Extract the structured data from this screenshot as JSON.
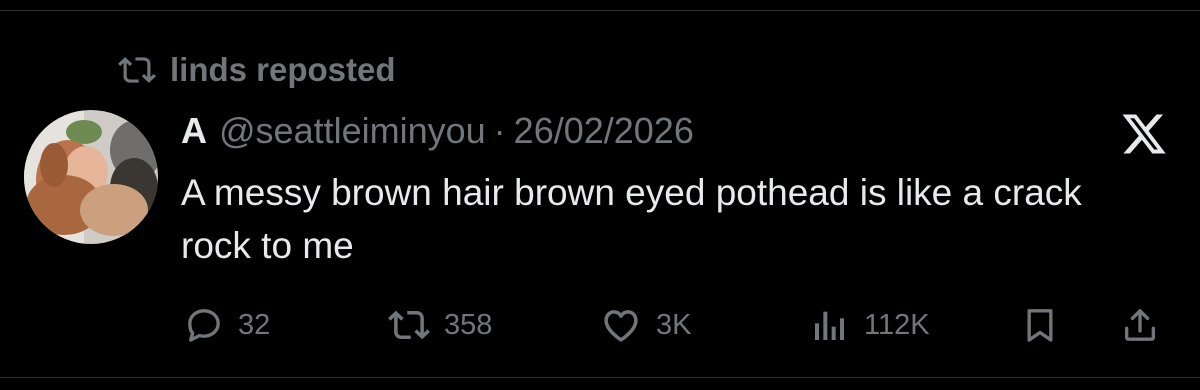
{
  "repost": {
    "label": "linds reposted",
    "icon": "repost-icon"
  },
  "post": {
    "author_name": "A",
    "handle": "@seattleiminyou",
    "separator": "·",
    "date": "26/02/2026",
    "text": "A messy brown hair brown eyed pothead is like a crack rock to me",
    "platform_icon": "x-logo-icon"
  },
  "actions": {
    "replies": "32",
    "reposts": "358",
    "likes": "3K",
    "views": "112K"
  },
  "colors": {
    "background": "#000000",
    "primary_text": "#e7e9ea",
    "secondary_text": "#71767b",
    "divider": "#2f3336"
  }
}
